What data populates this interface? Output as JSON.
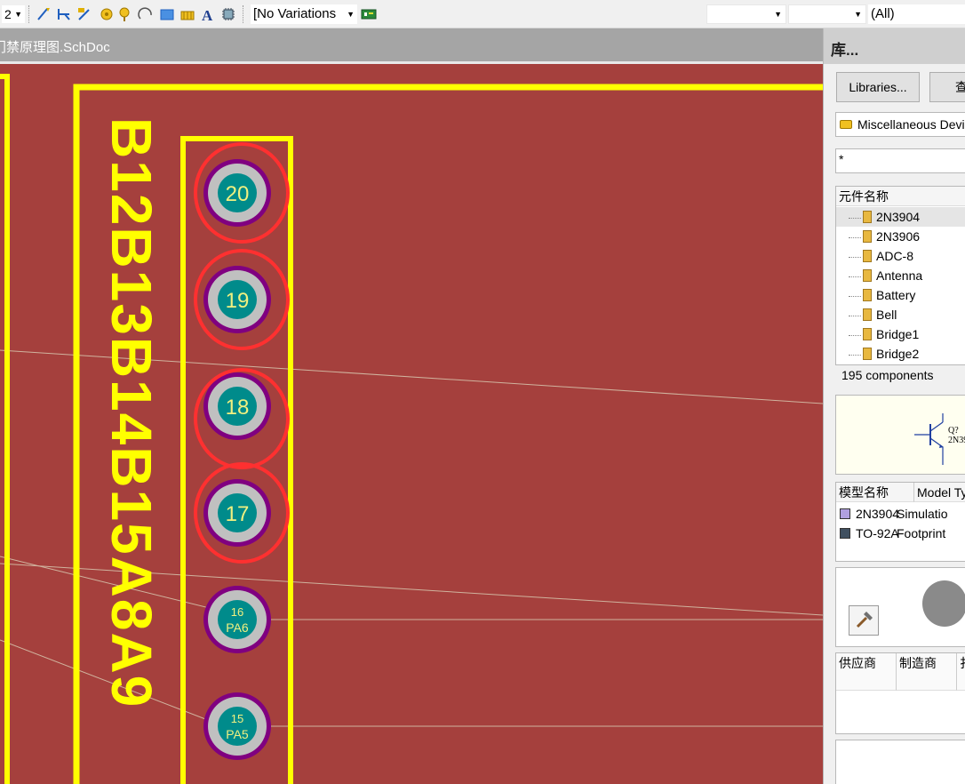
{
  "toolbar": {
    "sheet_combo_value": "2",
    "variations_value": "[No Variations",
    "filter_value": "(All)"
  },
  "document_tab": {
    "title": "门禁原理图.SchDoc"
  },
  "pcb": {
    "silk_text": "B12B13B14B15A8A9",
    "pads": [
      {
        "number": "20",
        "net": "",
        "circled": true
      },
      {
        "number": "19",
        "net": "",
        "circled": true
      },
      {
        "number": "18",
        "net": "",
        "circled": true
      },
      {
        "number": "17",
        "net": "",
        "circled": true
      },
      {
        "number": "16",
        "net": "PA6",
        "circled": false
      },
      {
        "number": "15",
        "net": "PA5",
        "circled": false
      }
    ],
    "colors": {
      "board": "#a5403d",
      "outline": "#ffff00",
      "pad_ring": "#800080",
      "pad_face": "#c0c0c0",
      "pad_center": "#008b8b",
      "highlight": "#ff3030"
    }
  },
  "library_panel": {
    "title": "库...",
    "libraries_button": "Libraries...",
    "search_button": "查",
    "library_name": "Miscellaneous Devic",
    "filter_text": "*",
    "component_list_header": "元件名称",
    "components": [
      "2N3904",
      "2N3906",
      "ADC-8",
      "Antenna",
      "Battery",
      "Bell",
      "Bridge1",
      "Bridge2"
    ],
    "selected_component": "2N3904",
    "component_count": "195 components",
    "preview": {
      "designator": "Q?",
      "part": "2N39"
    },
    "model_header": {
      "name": "模型名称",
      "type": "Model Ty"
    },
    "models": [
      {
        "name": "2N3904",
        "type": "Simulatio"
      },
      {
        "name": "TO-92A",
        "type": "Footprint"
      }
    ],
    "supplier_header": {
      "supplier": "供应商",
      "manufacturer": "制造商",
      "desc": "扌"
    }
  }
}
